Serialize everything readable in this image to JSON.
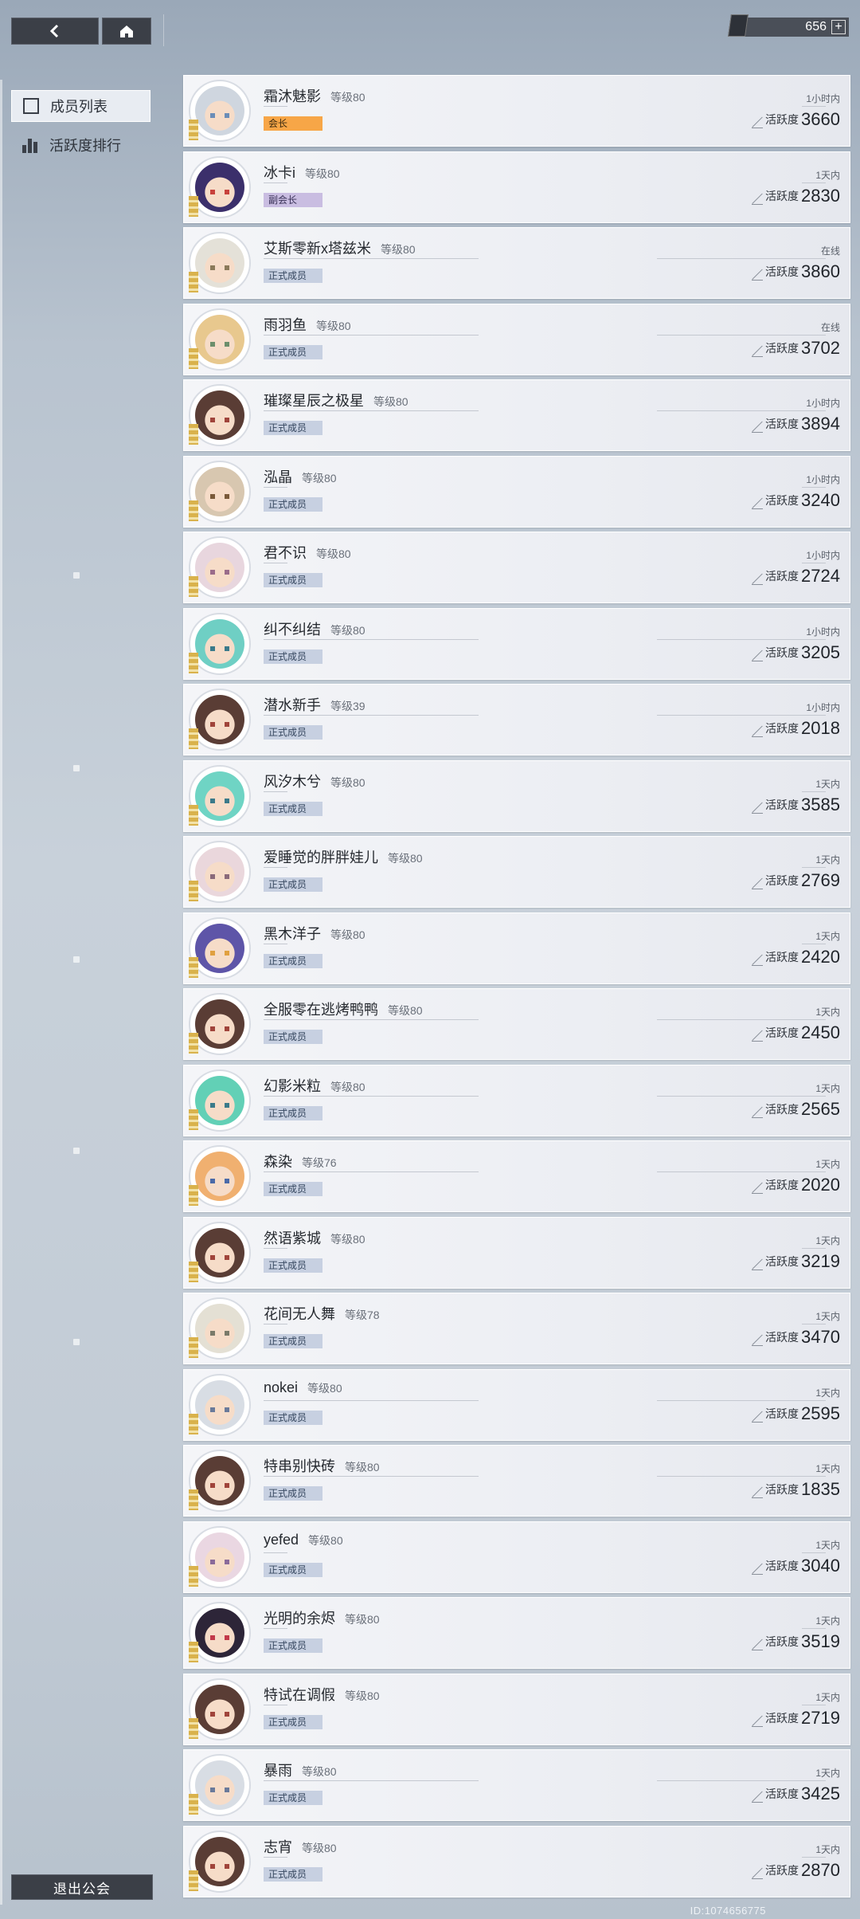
{
  "topbar": {
    "currency_value": "656",
    "plus_label": "+"
  },
  "sidebar": {
    "items": [
      {
        "label": "成员列表",
        "active": true,
        "icon": "members-icon"
      },
      {
        "label": "活跃度排行",
        "active": false,
        "icon": "ranking-icon"
      }
    ],
    "exit_label": "退出公会"
  },
  "footer": {
    "id_text": "ID:1074656775"
  },
  "members": [
    {
      "name": "霜沐魅影",
      "level": "等级80",
      "role": "会长",
      "role_type": "leader",
      "last_online": "1小时内",
      "activity_label": "活跃度",
      "activity": "3660",
      "hair": "#cfd6df",
      "eye": "#6b8db8",
      "underline": "short"
    },
    {
      "name": "冰卡i",
      "level": "等级80",
      "role": "副会长",
      "role_type": "vice",
      "last_online": "1天内",
      "activity_label": "活跃度",
      "activity": "2830",
      "hair": "#3b2f6b",
      "eye": "#c8413c",
      "underline": "short"
    },
    {
      "name": "艾斯零新x塔兹米",
      "level": "等级80",
      "role": "正式成员",
      "role_type": "member",
      "last_online": "在线",
      "activity_label": "活跃度",
      "activity": "3860",
      "hair": "#e4e1d8",
      "eye": "#8b7a5a",
      "underline": "long"
    },
    {
      "name": "雨羽鱼",
      "level": "等级80",
      "role": "正式成员",
      "role_type": "member",
      "last_online": "在线",
      "activity_label": "活跃度",
      "activity": "3702",
      "hair": "#e8c88e",
      "eye": "#6c8f6c",
      "underline": "long"
    },
    {
      "name": "璀璨星辰之极星",
      "level": "等级80",
      "role": "正式成员",
      "role_type": "member",
      "last_online": "1小时内",
      "activity_label": "活跃度",
      "activity": "3894",
      "hair": "#5a3d35",
      "eye": "#a0443b",
      "underline": "long"
    },
    {
      "name": "泓晶",
      "level": "等级80",
      "role": "正式成员",
      "role_type": "member",
      "last_online": "1小时内",
      "activity_label": "活跃度",
      "activity": "3240",
      "hair": "#d8c7b0",
      "eye": "#7a5a3a",
      "underline": "short"
    },
    {
      "name": "君不识",
      "level": "等级80",
      "role": "正式成员",
      "role_type": "member",
      "last_online": "1小时内",
      "activity_label": "活跃度",
      "activity": "2724",
      "hair": "#e8d6de",
      "eye": "#9a6c8a",
      "underline": "short"
    },
    {
      "name": "纠不纠结",
      "level": "等级80",
      "role": "正式成员",
      "role_type": "member",
      "last_online": "1小时内",
      "activity_label": "活跃度",
      "activity": "3205",
      "hair": "#6fcfc4",
      "eye": "#3a7a8a",
      "underline": "long"
    },
    {
      "name": "潜水新手",
      "level": "等级39",
      "role": "正式成员",
      "role_type": "member",
      "last_online": "1小时内",
      "activity_label": "活跃度",
      "activity": "2018",
      "hair": "#5a3d35",
      "eye": "#a0443b",
      "underline": "long"
    },
    {
      "name": "风汐木兮",
      "level": "等级80",
      "role": "正式成员",
      "role_type": "member",
      "last_online": "1天内",
      "activity_label": "活跃度",
      "activity": "3585",
      "hair": "#6fd4c4",
      "eye": "#3a7a8a",
      "underline": "short"
    },
    {
      "name": "爱睡觉的胖胖娃儿",
      "level": "等级80",
      "role": "正式成员",
      "role_type": "member",
      "last_online": "1天内",
      "activity_label": "活跃度",
      "activity": "2769",
      "hair": "#ead7dc",
      "eye": "#8a6a7a",
      "underline": "short"
    },
    {
      "name": "黑木洋子",
      "level": "等级80",
      "role": "正式成员",
      "role_type": "member",
      "last_online": "1天内",
      "activity_label": "活跃度",
      "activity": "2420",
      "hair": "#5e55a8",
      "eye": "#e0a040",
      "underline": "short"
    },
    {
      "name": "全服零在逃烤鸭鸭",
      "level": "等级80",
      "role": "正式成员",
      "role_type": "member",
      "last_online": "1天内",
      "activity_label": "活跃度",
      "activity": "2450",
      "hair": "#5a3d35",
      "eye": "#a0443b",
      "underline": "long"
    },
    {
      "name": "幻影米粒",
      "level": "等级80",
      "role": "正式成员",
      "role_type": "member",
      "last_online": "1天内",
      "activity_label": "活跃度",
      "activity": "2565",
      "hair": "#62d0b6",
      "eye": "#3a7a8a",
      "underline": "long"
    },
    {
      "name": "森染",
      "level": "等级76",
      "role": "正式成员",
      "role_type": "member",
      "last_online": "1天内",
      "activity_label": "活跃度",
      "activity": "2020",
      "hair": "#f0b070",
      "eye": "#4a6aa8",
      "underline": "long"
    },
    {
      "name": "然语紫城",
      "level": "等级80",
      "role": "正式成员",
      "role_type": "member",
      "last_online": "1天内",
      "activity_label": "活跃度",
      "activity": "3219",
      "hair": "#5a3d35",
      "eye": "#a0443b",
      "underline": "short"
    },
    {
      "name": "花间无人舞",
      "level": "等级78",
      "role": "正式成员",
      "role_type": "member",
      "last_online": "1天内",
      "activity_label": "活跃度",
      "activity": "3470",
      "hair": "#e4e0d4",
      "eye": "#7a7a6a",
      "underline": "short"
    },
    {
      "name": "nokei",
      "level": "等级80",
      "role": "正式成员",
      "role_type": "member",
      "last_online": "1天内",
      "activity_label": "活跃度",
      "activity": "2595",
      "hair": "#d8dde4",
      "eye": "#6a7a9a",
      "underline": "long"
    },
    {
      "name": "特串别快砖",
      "level": "等级80",
      "role": "正式成员",
      "role_type": "member",
      "last_online": "1天内",
      "activity_label": "活跃度",
      "activity": "1835",
      "hair": "#5a3d35",
      "eye": "#a0443b",
      "underline": "long"
    },
    {
      "name": "yefed",
      "level": "等级80",
      "role": "正式成员",
      "role_type": "member",
      "last_online": "1天内",
      "activity_label": "活跃度",
      "activity": "3040",
      "hair": "#ead7e2",
      "eye": "#8a6a9a",
      "underline": "short"
    },
    {
      "name": "光明的余烬",
      "level": "等级80",
      "role": "正式成员",
      "role_type": "member",
      "last_online": "1天内",
      "activity_label": "活跃度",
      "activity": "3519",
      "hair": "#2d2538",
      "eye": "#c23a4a",
      "underline": "short"
    },
    {
      "name": "特试在调假",
      "level": "等级80",
      "role": "正式成员",
      "role_type": "member",
      "last_online": "1天内",
      "activity_label": "活跃度",
      "activity": "2719",
      "hair": "#5a3d35",
      "eye": "#a0443b",
      "underline": "short"
    },
    {
      "name": "暴雨",
      "level": "等级80",
      "role": "正式成员",
      "role_type": "member",
      "last_online": "1天内",
      "activity_label": "活跃度",
      "activity": "3425",
      "hair": "#d8dde4",
      "eye": "#6a7a9a",
      "underline": "long"
    },
    {
      "name": "志宵",
      "level": "等级80",
      "role": "正式成员",
      "role_type": "member",
      "last_online": "1天内",
      "activity_label": "活跃度",
      "activity": "2870",
      "hair": "#5a3d35",
      "eye": "#a0443b",
      "underline": "short"
    }
  ]
}
